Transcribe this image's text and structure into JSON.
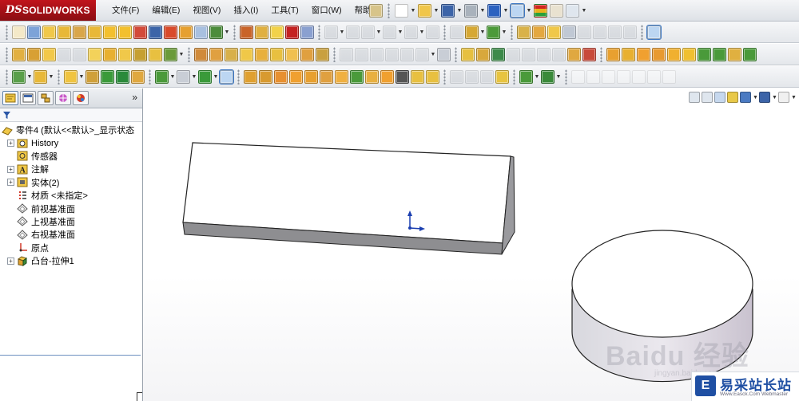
{
  "app": {
    "brand_mark": "DS",
    "brand_name": "SOLIDWORKS",
    "brand_color": "#b3121a"
  },
  "menu": [
    "文件(F)",
    "编辑(E)",
    "视图(V)",
    "插入(I)",
    "工具(T)",
    "窗口(W)",
    "帮助(H)"
  ],
  "tree": {
    "expand_symbol": "»",
    "items": [
      {
        "label": "零件4 (默认<<默认>_显示状态",
        "icon": "part-icon",
        "expandable": false
      },
      {
        "label": "History",
        "icon": "history-folder-icon",
        "expandable": true
      },
      {
        "label": "传感器",
        "icon": "sensor-icon",
        "expandable": false
      },
      {
        "label": "注解",
        "icon": "annotations-icon",
        "expandable": true
      },
      {
        "label": "实体(2)",
        "icon": "solid-bodies-icon",
        "expandable": true
      },
      {
        "label": "材质 <未指定>",
        "icon": "material-icon",
        "expandable": false
      },
      {
        "label": "前视基准面",
        "icon": "plane-icon",
        "expandable": false
      },
      {
        "label": "上视基准面",
        "icon": "plane-icon",
        "expandable": false
      },
      {
        "label": "右视基准面",
        "icon": "plane-icon",
        "expandable": false
      },
      {
        "label": "原点",
        "icon": "origin-icon",
        "expandable": false
      },
      {
        "label": "凸台-拉伸1",
        "icon": "boss-extrude-icon",
        "expandable": true
      }
    ]
  },
  "watermark": {
    "text": "Baidu 经验",
    "sub": "jingyan.baidu.com"
  },
  "site_badge": {
    "logo_char": "E",
    "name": "易采站长站",
    "url": "Www.Easck.Com Webmaster"
  },
  "colors": {
    "accent": "#3d78c4",
    "tree_selection_line": "#6d8fbf",
    "site_blue": "#1f4fa3"
  }
}
